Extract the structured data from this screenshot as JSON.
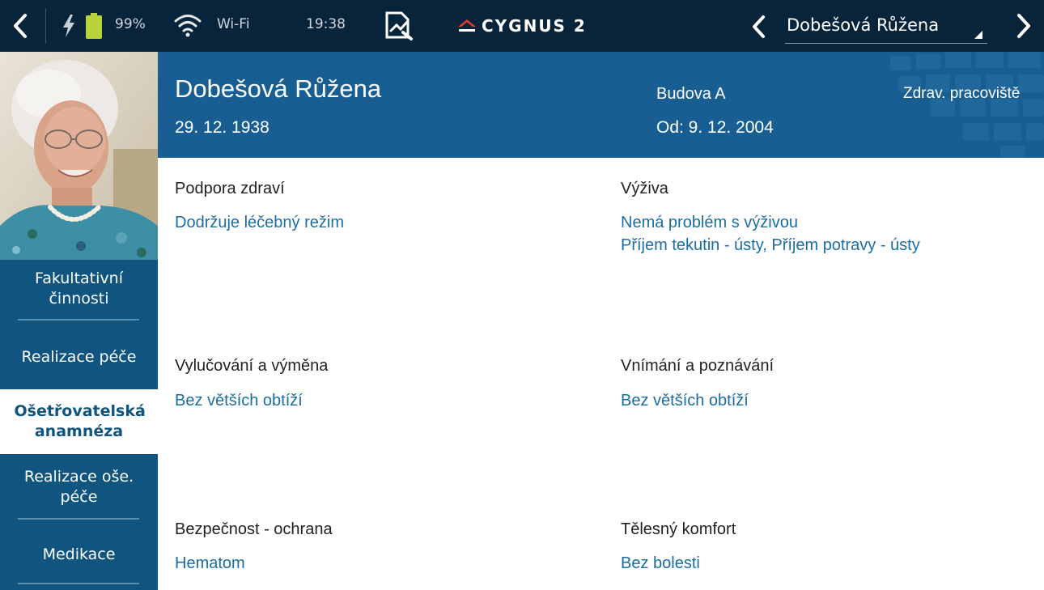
{
  "status_bar": {
    "battery_percent": "99%",
    "wifi_label": "Wi-Fi",
    "time": "19:38",
    "logo_text": "CYGNUS 2",
    "patient_selector_value": "Dobešová Růžena",
    "colors": {
      "background": "#08243a",
      "battery": "#b7d23a"
    },
    "icons": [
      "back-arrow-icon",
      "charging-bolt-icon",
      "battery-icon",
      "wifi-icon",
      "signature-icon",
      "cygnus-logo-icon",
      "previous-patient-icon",
      "next-patient-icon"
    ]
  },
  "sidebar": {
    "photo_alt": "patient-photo",
    "items": [
      {
        "label": "Fakultativní činnosti",
        "active": false
      },
      {
        "label": "Realizace péče",
        "active": false
      },
      {
        "label": "Ošetřovatelská anamnéza",
        "active": true
      },
      {
        "label": "Realizace oše. péče",
        "active": false
      },
      {
        "label": "Medikace",
        "active": false
      }
    ],
    "colors": {
      "background": "#10557f",
      "active_background": "#ffffff"
    }
  },
  "header": {
    "patient_name": "Dobešová Růžena",
    "date_of_birth": "29. 12. 1938",
    "building": "Budova A",
    "from_date": "Od: 9. 12. 2004",
    "workplace": "Zdrav. pracoviště",
    "colors": {
      "background": "#195e92"
    }
  },
  "sections": [
    {
      "title": "Podpora zdraví",
      "values": [
        "Dodržuje léčebný režim"
      ]
    },
    {
      "title": "Výživa",
      "values": [
        "Nemá problém s výživou",
        "Příjem tekutin - ústy, Příjem potravy - ústy"
      ]
    },
    {
      "title": "Vylučování a výměna",
      "values": [
        "Bez větších obtíží"
      ]
    },
    {
      "title": "Vnímání a poznávání",
      "values": [
        "Bez větších obtíží"
      ]
    },
    {
      "title": "Bezpečnost - ochrana",
      "values": [
        "Hematom"
      ]
    },
    {
      "title": "Tělesný komfort",
      "values": [
        "Bez bolesti"
      ]
    }
  ]
}
